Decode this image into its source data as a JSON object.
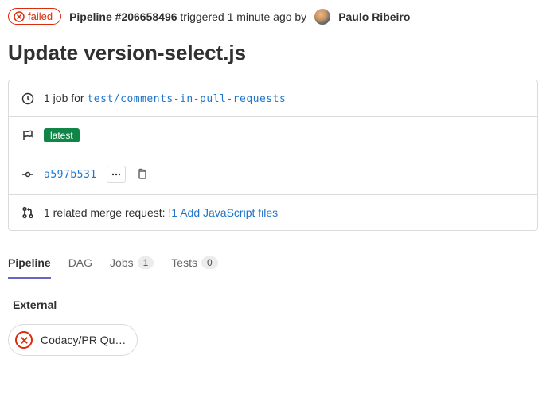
{
  "status": {
    "label": "failed"
  },
  "header": {
    "pipeline_prefix": "Pipeline",
    "pipeline_id": "#206658496",
    "triggered_text": "triggered 1 minute ago by",
    "author": "Paulo Ribeiro"
  },
  "title": "Update version-select.js",
  "info": {
    "job_count_text": "1 job for",
    "branch": "test/comments-in-pull-requests",
    "tag": "latest",
    "commit_sha": "a597b531",
    "mr_text": "1 related merge request:",
    "mr_link": "!1 Add JavaScript files"
  },
  "tabs": {
    "pipeline": "Pipeline",
    "dag": "DAG",
    "jobs": "Jobs",
    "jobs_count": "1",
    "tests": "Tests",
    "tests_count": "0"
  },
  "stage": {
    "name": "External",
    "job": "Codacy/PR Qu…"
  }
}
